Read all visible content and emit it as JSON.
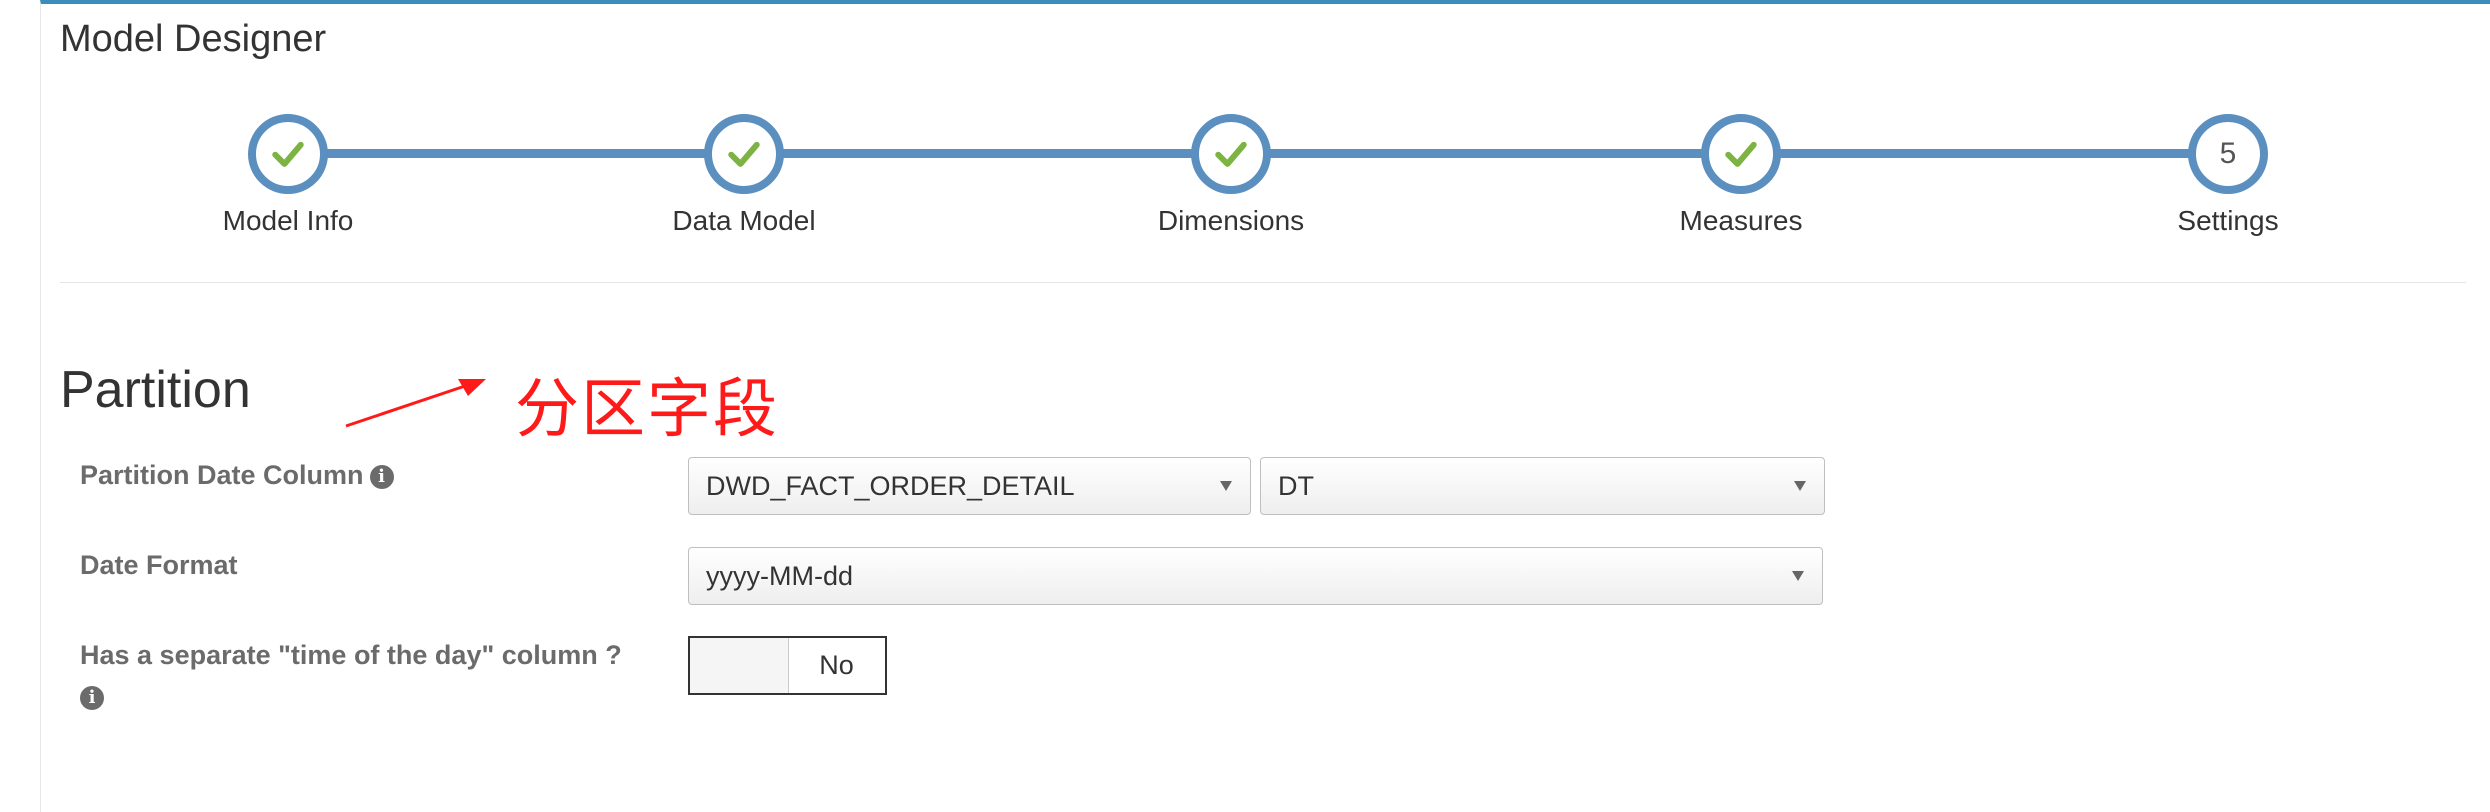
{
  "header": {
    "title": "Model Designer"
  },
  "wizard": {
    "steps": [
      {
        "label": "Model Info",
        "status": "complete",
        "icon": "check-icon"
      },
      {
        "label": "Data Model",
        "status": "complete",
        "icon": "check-icon"
      },
      {
        "label": "Dimensions",
        "status": "complete",
        "icon": "check-icon"
      },
      {
        "label": "Measures",
        "status": "complete",
        "icon": "check-icon"
      },
      {
        "label": "Settings",
        "status": "current",
        "number": "5"
      }
    ],
    "colors": {
      "accent": "#5b8fbf",
      "check": "#7cb342"
    }
  },
  "partition": {
    "title": "Partition",
    "annotation": "分区字段",
    "annotation_color": "#ff1a1a",
    "date_column": {
      "label": "Partition Date Column",
      "table_value": "DWD_FACT_ORDER_DETAIL",
      "column_value": "DT"
    },
    "date_format": {
      "label": "Date Format",
      "value": "yyyy-MM-dd"
    },
    "time_column": {
      "label": "Has a separate \"time of the day\" column ?",
      "toggle_value": "No"
    }
  }
}
